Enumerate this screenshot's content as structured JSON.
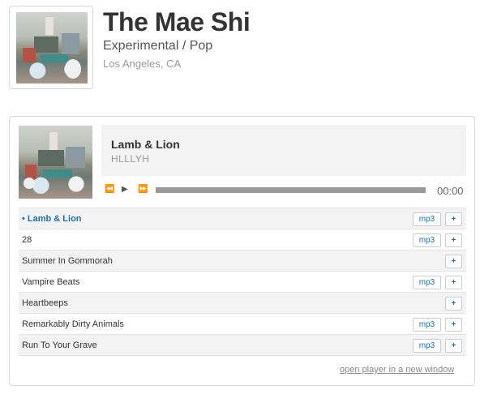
{
  "artist": {
    "name": "The Mae Shi",
    "genre": "Experimental / Pop",
    "location": "Los Angeles, CA"
  },
  "player": {
    "now_playing": {
      "title": "Lamb & Lion",
      "album": "HLLLYH"
    },
    "controls": {
      "rewind_glyph": "⏪",
      "play_glyph": "▶",
      "ffwd_glyph": "⏩"
    },
    "progress": 0,
    "time": "00:00",
    "tracks": [
      {
        "title": "• Lamb & Lion",
        "mp3": "mp3",
        "add": "+"
      },
      {
        "title": "28",
        "mp3": "mp3",
        "add": "+"
      },
      {
        "title": "Summer In Gommorah",
        "mp3": null,
        "add": "+"
      },
      {
        "title": "Vampire Beats",
        "mp3": "mp3",
        "add": "+"
      },
      {
        "title": "Heartbeeps",
        "mp3": null,
        "add": "+"
      },
      {
        "title": "Remarkably Dirty Animals",
        "mp3": "mp3",
        "add": "+"
      },
      {
        "title": "Run To Your Grave",
        "mp3": "mp3",
        "add": "+"
      }
    ],
    "open_link": "open player in a new window"
  }
}
